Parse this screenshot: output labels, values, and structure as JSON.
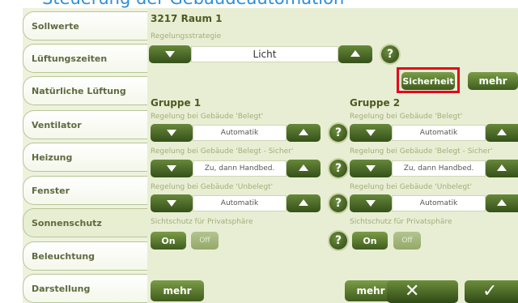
{
  "window": {
    "title_fragment": "Steuerung der Gebäudeautomation"
  },
  "sidebar": {
    "items": [
      {
        "label": "Sollwerte"
      },
      {
        "label": "Lüftungszeiten"
      },
      {
        "label": "Natürliche Lüftung"
      },
      {
        "label": "Ventilator"
      },
      {
        "label": "Heizung"
      },
      {
        "label": "Fenster"
      },
      {
        "label": "Sonnenschutz"
      },
      {
        "label": "Beleuchtung"
      },
      {
        "label": "Darstellung"
      }
    ]
  },
  "header": {
    "title": "3217 Raum 1",
    "strategy_label": "Regelungsstrategie",
    "strategy_value": "Licht"
  },
  "buttons": {
    "sicherheit": "Sicherheit",
    "mehr": "mehr",
    "mehr_bottom_left": "mehr",
    "mehr_bottom_right": "mehr",
    "cancel": "✕",
    "ok": "✓",
    "help": "?"
  },
  "group1": {
    "title": "Gruppe 1",
    "rows": [
      {
        "label": "Regelung bei Gebäude 'Belegt'",
        "value": "Automatik"
      },
      {
        "label": "Regelung bei Gebäude 'Belegt - Sicher'",
        "value": "Zu, dann Handbed."
      },
      {
        "label": "Regelung bei Gebäude 'Unbelegt'",
        "value": "Automatik"
      }
    ],
    "privacy_label": "Sichtschutz für Privatsphäre",
    "on": "On",
    "off": "Off"
  },
  "group2": {
    "title": "Gruppe 2",
    "rows": [
      {
        "label": "Regelung bei Gebäude 'Belegt'",
        "value": "Automatik"
      },
      {
        "label": "Regelung bei Gebäude 'Belegt - Sicher'",
        "value": "Zu, dann Handbed."
      },
      {
        "label": "Regelung bei Gebäude 'Unbelegt'",
        "value": "Automatik"
      }
    ],
    "privacy_label": "Sichtschutz für Privatsphäre",
    "on": "On",
    "off": "Off"
  },
  "colors": {
    "accent_green": "#4d6a26",
    "panel_bg": "#e8eed3",
    "highlight_red": "#e3051b",
    "title_blue": "#2f8fd6"
  }
}
